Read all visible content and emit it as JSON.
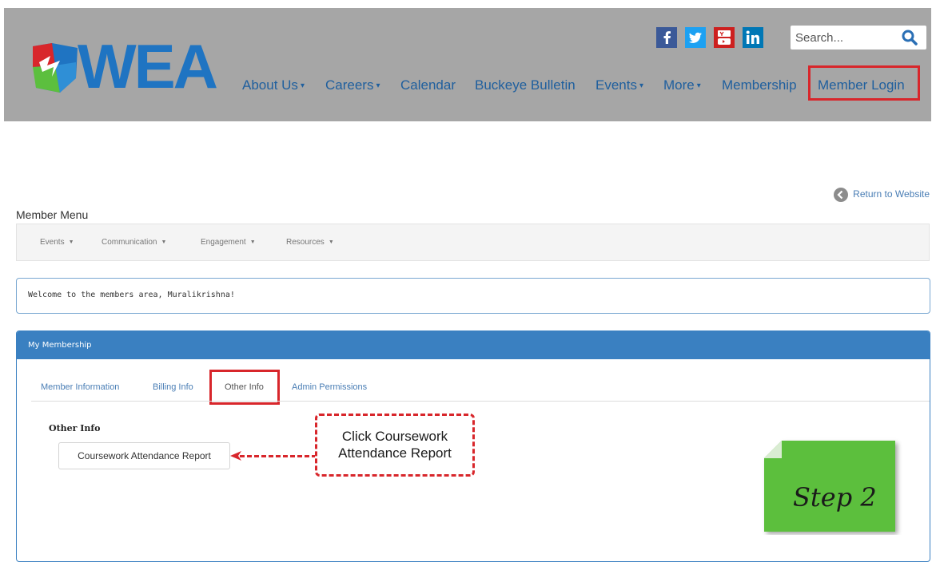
{
  "header": {
    "logo_text": "WEA",
    "social": [
      "facebook-icon",
      "twitter-icon",
      "youtube-icon",
      "linkedin-icon"
    ],
    "search": {
      "placeholder": "Search..."
    },
    "nav": [
      {
        "label": "About Us",
        "dropdown": true
      },
      {
        "label": "Careers",
        "dropdown": true
      },
      {
        "label": "Calendar",
        "dropdown": false
      },
      {
        "label": "Buckeye Bulletin",
        "dropdown": false
      },
      {
        "label": "Events",
        "dropdown": true
      },
      {
        "label": "More",
        "dropdown": true
      },
      {
        "label": "Membership",
        "dropdown": false
      },
      {
        "label": "Member Login",
        "dropdown": false
      }
    ]
  },
  "return_link": "Return to Website",
  "member_menu": {
    "title": "Member Menu",
    "items": [
      "Events",
      "Communication",
      "Engagement",
      "Resources"
    ]
  },
  "welcome": "Welcome to the members area, Muralikrishna!",
  "panel": {
    "title": "My Membership",
    "tabs": [
      "Member Information",
      "Billing Info",
      "Other Info",
      "Admin Permissions"
    ],
    "active_tab": "Other Info",
    "section_title": "Other Info",
    "button_label": "Coursework Attendance Report"
  },
  "annotations": {
    "callout_line1": "Click Coursework",
    "callout_line2": "Attendance Report",
    "step_label": "Step 2"
  },
  "colors": {
    "header_bg": "#a6a6a6",
    "brand_blue": "#1f74c2",
    "nav_text": "#1f5f9e",
    "highlight_red": "#d8262b",
    "panel_blue": "#3a80c1",
    "step_green": "#5cbf3e"
  }
}
